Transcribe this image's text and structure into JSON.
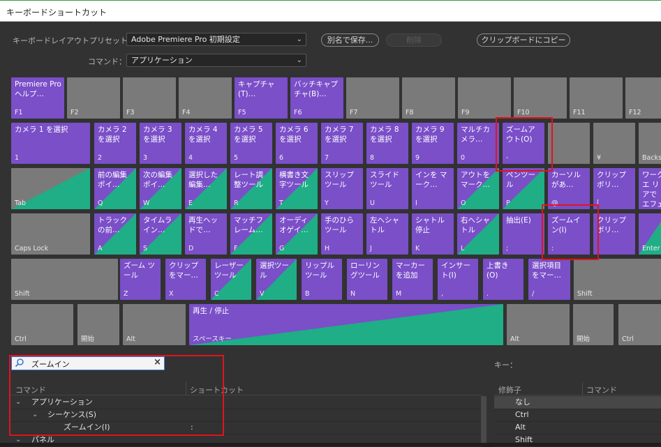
{
  "window": {
    "title": "キーボードショートカット"
  },
  "preset": {
    "label": "キーボードレイアウトプリセット：",
    "value": "Adobe Premiere Pro 初期設定"
  },
  "command": {
    "label": "コマンド：",
    "value": "アプリケーション"
  },
  "buttons": {
    "save_as": "別名で保存...",
    "delete": "削除",
    "copy_clipboard": "クリップボードにコピー"
  },
  "keyboard": {
    "row1": [
      {
        "top": "Premiere Pro ヘルプ…",
        "bot": "F1"
      },
      {
        "top": "",
        "bot": "F2"
      },
      {
        "top": "",
        "bot": "F3"
      },
      {
        "top": "",
        "bot": "F4"
      },
      {
        "top": "キャプチャ (T)…",
        "bot": "F5"
      },
      {
        "top": "バッチキャプ チャ(B)…",
        "bot": "F6"
      },
      {
        "top": "",
        "bot": "F7"
      },
      {
        "top": "",
        "bot": "F8"
      },
      {
        "top": "",
        "bot": "F9"
      },
      {
        "top": "",
        "bot": "F10"
      },
      {
        "top": "",
        "bot": "F11"
      },
      {
        "top": "",
        "bot": "F12"
      }
    ],
    "row2": [
      {
        "top": "カメラ 1 を選択",
        "bot": "1"
      },
      {
        "top": "カメラ 2 を選択",
        "bot": "2"
      },
      {
        "top": "カメラ 3 を選択",
        "bot": "3"
      },
      {
        "top": "カメラ 4 を選択",
        "bot": "4"
      },
      {
        "top": "カメラ 5 を選択",
        "bot": "5"
      },
      {
        "top": "カメラ 6 を選択",
        "bot": "6"
      },
      {
        "top": "カメラ 7 を選択",
        "bot": "7"
      },
      {
        "top": "カメラ 8 を選択",
        "bot": "8"
      },
      {
        "top": "カメラ 9 を選択",
        "bot": "9"
      },
      {
        "top": "マルチカ メラ…",
        "bot": "0"
      },
      {
        "top": "ズームア ウト(O)",
        "bot": "-"
      },
      {
        "top": "",
        "bot": ""
      },
      {
        "top": "",
        "bot": "¥"
      },
      {
        "top": "",
        "bot": "Backspace"
      }
    ],
    "row3": [
      {
        "top": "",
        "bot": "Tab"
      },
      {
        "top": "前の編集 ポイ…",
        "bot": "Q"
      },
      {
        "top": "次の編集 ポイ…",
        "bot": "W"
      },
      {
        "top": "選択した 編集…",
        "bot": "E"
      },
      {
        "top": "レート調 整ツール",
        "bot": "R"
      },
      {
        "top": "横書き文 字ツール",
        "bot": "T"
      },
      {
        "top": "スリップ ツール",
        "bot": "Y"
      },
      {
        "top": "スライド ツール",
        "bot": "U"
      },
      {
        "top": "インを マーク…",
        "bot": "I"
      },
      {
        "top": "アウトを マーク…",
        "bot": "O"
      },
      {
        "top": "ペンツー ル",
        "bot": "P"
      },
      {
        "top": "カーソル があ…",
        "bot": "@"
      },
      {
        "top": "クリップ ボリ…",
        "bot": "["
      },
      {
        "top": "ワークエ リアで エフェ クトを レンダ リング (R)",
        "bot": ""
      }
    ],
    "row4": [
      {
        "top": "",
        "bot": "Caps Lock"
      },
      {
        "top": "トラック の前…",
        "bot": "A"
      },
      {
        "top": "タイムラ イン…",
        "bot": "S"
      },
      {
        "top": "再生ヘッ ドで…",
        "bot": "D"
      },
      {
        "top": "マッチフ レーム…",
        "bot": "F"
      },
      {
        "top": "オーディ オゲイ…",
        "bot": "G"
      },
      {
        "top": "手のひら ツール",
        "bot": "H"
      },
      {
        "top": "左へシャ トル",
        "bot": "J"
      },
      {
        "top": "シャトル 停止",
        "bot": "K"
      },
      {
        "top": "右へシャ トル",
        "bot": "L"
      },
      {
        "top": "抽出(E)",
        "bot": ";"
      },
      {
        "top": "ズームイ ン(I)",
        "bot": ":"
      },
      {
        "top": "クリップ ボリ…",
        "bot": "]"
      },
      {
        "top": "",
        "bot": "Enter"
      }
    ],
    "row5": [
      {
        "top": "",
        "bot": "Shift"
      },
      {
        "top": "ズーム ツール",
        "bot": "Z"
      },
      {
        "top": "クリップ をマー…",
        "bot": "X"
      },
      {
        "top": "レーザー ツール",
        "bot": "C"
      },
      {
        "top": "選択ツー ル",
        "bot": "V"
      },
      {
        "top": "リップル ツール",
        "bot": "B"
      },
      {
        "top": "ローリン グツール",
        "bot": "N"
      },
      {
        "top": "マーカー を追加",
        "bot": "M"
      },
      {
        "top": "インサー ト(I)",
        "bot": ","
      },
      {
        "top": "上書き (O)",
        "bot": "."
      },
      {
        "top": "選択項目 をマー…",
        "bot": "/"
      },
      {
        "top": "",
        "bot": "Shift"
      }
    ],
    "row6": [
      {
        "top": "",
        "bot": "Ctrl"
      },
      {
        "top": "",
        "bot": "開始"
      },
      {
        "top": "",
        "bot": "Alt"
      },
      {
        "top": "再生 / 停止",
        "bot": "スペースキー"
      },
      {
        "top": "",
        "bot": "Alt"
      },
      {
        "top": "",
        "bot": "開始"
      },
      {
        "top": "",
        "bot": "Ctrl"
      }
    ]
  },
  "search": {
    "value": "ズームイン",
    "clear": "×"
  },
  "list": {
    "col_command": "コマンド",
    "col_shortcut": "ショートカット",
    "rows": [
      {
        "label": "アプリケーション",
        "shortcut": ""
      },
      {
        "label": "シーケンス(S)",
        "shortcut": ""
      },
      {
        "label": "ズームイン(I)",
        "shortcut": ":"
      },
      {
        "label": "パネル",
        "shortcut": ""
      }
    ]
  },
  "key_panel": {
    "label": "キー：",
    "col_modifier": "修飾子",
    "col_command": "コマンド",
    "modifiers": [
      "なし",
      "Ctrl",
      "Alt",
      "Shift"
    ]
  },
  "colors": {
    "purple": "#7a4fc8",
    "green": "#1fae86",
    "key_gray": "#7a7a7a",
    "highlight_red": "#e0141e"
  }
}
